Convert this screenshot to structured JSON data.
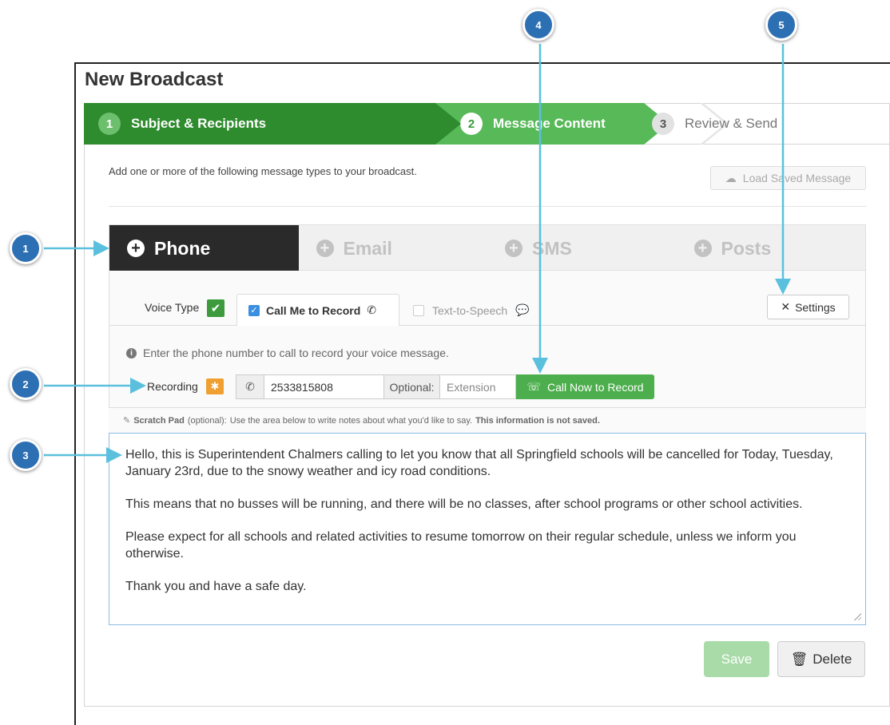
{
  "title": "New Broadcast",
  "wizard": {
    "steps": [
      {
        "num": "1",
        "label": "Subject & Recipients"
      },
      {
        "num": "2",
        "label": "Message Content"
      },
      {
        "num": "3",
        "label": "Review & Send"
      }
    ]
  },
  "intro_text": "Add one or more of the following message types to your broadcast.",
  "load_saved_label": "Load Saved Message",
  "message_tabs": [
    {
      "label": "Phone"
    },
    {
      "label": "Email"
    },
    {
      "label": "SMS"
    },
    {
      "label": "Posts"
    }
  ],
  "voice_type": {
    "label": "Voice Type",
    "call_me_label": "Call Me to Record",
    "tts_label": "Text-to-Speech"
  },
  "settings_label": "Settings",
  "info_text": "Enter the phone number to call to record your voice message.",
  "recording": {
    "label": "Recording",
    "phone_value": "2533815808",
    "optional_label": "Optional:",
    "extension_placeholder": "Extension",
    "call_now_label": "Call Now to Record"
  },
  "scratch": {
    "title": "Scratch Pad",
    "optional": "(optional):",
    "instructions": "Use the area below to write notes about what you'd like to say.",
    "not_saved": "This information is not saved."
  },
  "message_paragraphs": [
    "Hello, this is Superintendent Chalmers calling to let you know that all Springfield schools will be cancelled for Today, Tuesday, January 23rd, due to the snowy weather and icy road conditions.",
    "This means that no busses will be running, and there will be no classes, after school programs or other school activities.",
    "Please expect for all schools and related activities to resume tomorrow on their regular schedule, unless we inform you otherwise.",
    "Thank you and have a safe day."
  ],
  "buttons": {
    "save": "Save",
    "delete": "Delete"
  },
  "callouts": [
    "1",
    "2",
    "3",
    "4",
    "5"
  ],
  "colors": {
    "dark_green": "#2e8b2e",
    "light_green": "#57b957",
    "callout_blue": "#2d6fb3",
    "arrow": "#5bc0de"
  }
}
